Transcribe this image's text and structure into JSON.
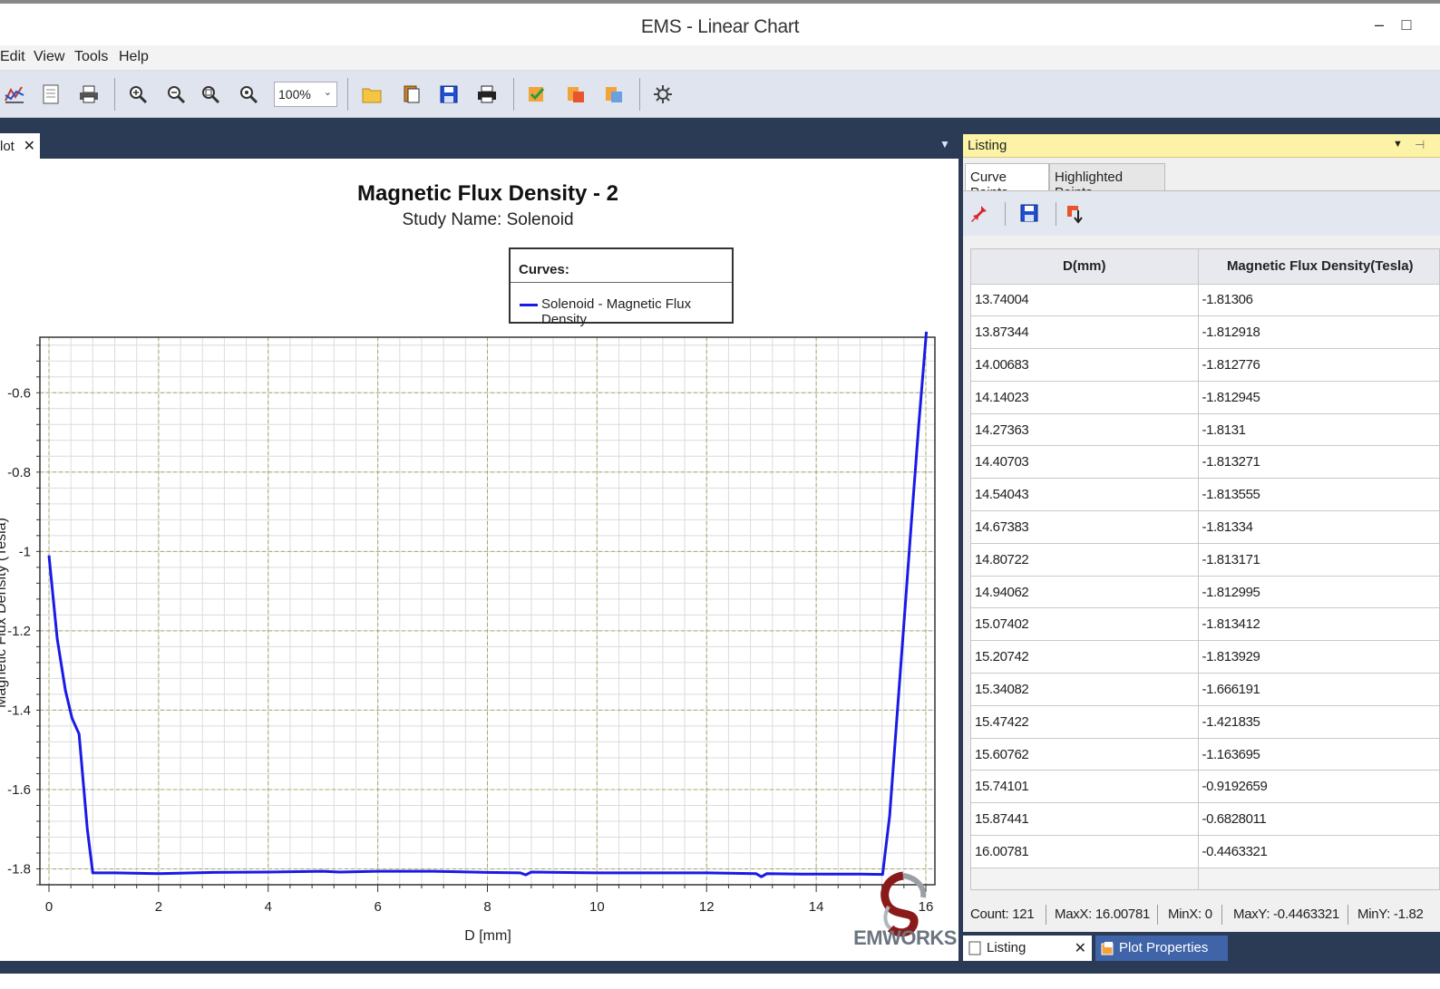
{
  "window": {
    "title": "EMS - Linear Chart",
    "minimize": "–",
    "maximize": "□"
  },
  "menu": {
    "items": [
      "Edit",
      "View",
      "Tools",
      "Help"
    ]
  },
  "toolbar": {
    "zoom_value": "100%",
    "icons": [
      "chart-icon",
      "page-icon",
      "print-preview-icon",
      "zoom-in-icon",
      "zoom-out-icon",
      "zoom-box-icon",
      "zoom-reset-icon",
      "open-folder-icon",
      "copy-icon",
      "save-icon",
      "print-icon",
      "checklist-icon",
      "export-image-icon",
      "export-data-icon",
      "settings-icon"
    ]
  },
  "plot_tab": {
    "label": "lot",
    "close": "✕"
  },
  "chart_data": {
    "type": "line",
    "title": "Magnetic Flux Density - 2",
    "subtitle": "Study Name: Solenoid",
    "legend_header": "Curves:",
    "legend_placement": "top-center",
    "xlabel": "D [mm]",
    "ylabel": "Magnetic Flux Density (Tesla)",
    "xlim": [
      0,
      16
    ],
    "ylim": [
      -1.84,
      -0.46
    ],
    "xticks": [
      0,
      2,
      4,
      6,
      8,
      10,
      12,
      14,
      16
    ],
    "xtick_labels": [
      "0",
      "2",
      "4",
      "6",
      "8",
      "10",
      "12",
      "14",
      "16"
    ],
    "yticks": [
      -0.6,
      -0.8,
      -1.0,
      -1.2,
      -1.4,
      -1.6,
      -1.8
    ],
    "ytick_labels": [
      "-0.6",
      "-0.8",
      "-1",
      "-1.2",
      "-1.4",
      "-1.6",
      "-1.8"
    ],
    "grid": true,
    "series": [
      {
        "name": "Solenoid - Magnetic Flux Density",
        "color": "#1a1ae6",
        "x": [
          0,
          0.15,
          0.3,
          0.42,
          0.55,
          0.7,
          0.8,
          1.2,
          2,
          3,
          4,
          5,
          5.3,
          6,
          7,
          8,
          8.6,
          8.7,
          8.8,
          10,
          12,
          12.9,
          13.0,
          13.1,
          13.74,
          14.27,
          14.81,
          15.21,
          15.34,
          15.47,
          15.61,
          15.74,
          15.87,
          16.01
        ],
        "y": [
          -1.01,
          -1.22,
          -1.35,
          -1.42,
          -1.46,
          -1.7,
          -1.81,
          -1.81,
          -1.812,
          -1.809,
          -1.808,
          -1.806,
          -1.808,
          -1.806,
          -1.806,
          -1.809,
          -1.81,
          -1.815,
          -1.808,
          -1.81,
          -1.81,
          -1.812,
          -1.82,
          -1.812,
          -1.813,
          -1.813,
          -1.813,
          -1.814,
          -1.666,
          -1.422,
          -1.164,
          -0.919,
          -0.683,
          -0.446
        ]
      }
    ]
  },
  "listing": {
    "title": "Listing",
    "tabs": [
      "Curve Points",
      "Highlighted Points"
    ],
    "columns": [
      "D(mm)",
      "Magnetic Flux Density(Tesla)"
    ],
    "rows": [
      [
        "13.74004",
        "-1.81306"
      ],
      [
        "13.87344",
        "-1.812918"
      ],
      [
        "14.00683",
        "-1.812776"
      ],
      [
        "14.14023",
        "-1.812945"
      ],
      [
        "14.27363",
        "-1.8131"
      ],
      [
        "14.40703",
        "-1.813271"
      ],
      [
        "14.54043",
        "-1.813555"
      ],
      [
        "14.67383",
        "-1.81334"
      ],
      [
        "14.80722",
        "-1.813171"
      ],
      [
        "14.94062",
        "-1.812995"
      ],
      [
        "15.07402",
        "-1.813412"
      ],
      [
        "15.20742",
        "-1.813929"
      ],
      [
        "15.34082",
        "-1.666191"
      ],
      [
        "15.47422",
        "-1.421835"
      ],
      [
        "15.60762",
        "-1.163695"
      ],
      [
        "15.74101",
        "-0.9192659"
      ],
      [
        "15.87441",
        "-0.6828011"
      ],
      [
        "16.00781",
        "-0.4463321"
      ]
    ],
    "status": {
      "count": "Count: 121",
      "maxx": "MaxX: 16.00781",
      "minx": "MinX: 0",
      "maxy": "MaxY: -0.4463321",
      "miny": "MinY: -1.82"
    }
  },
  "bottom_tabs": {
    "listing": "Listing",
    "listing_close": "✕",
    "properties": "Plot Properties"
  },
  "watermark": {
    "text": "EMWORKS",
    "brand_color": "#8a1a1a"
  }
}
